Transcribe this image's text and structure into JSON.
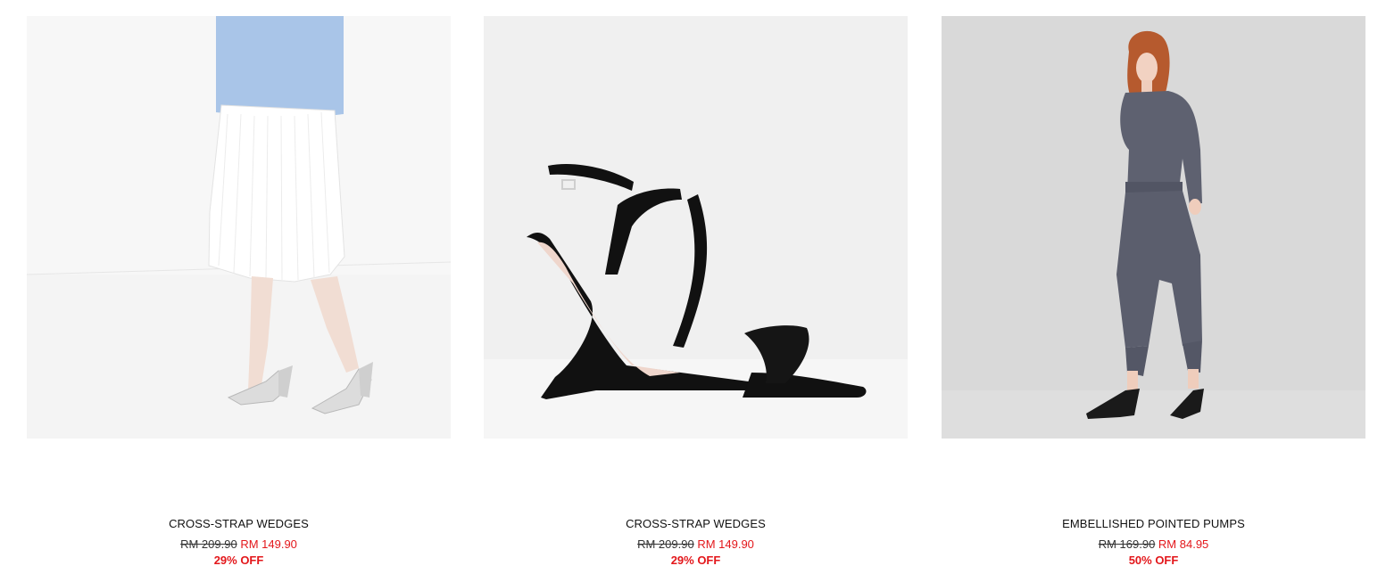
{
  "products": [
    {
      "name": "CROSS-STRAP WEDGES",
      "old_price": "RM 209.90",
      "new_price": "RM 149.90",
      "discount": "29% OFF",
      "image_desc": "model-legs-silver-wedges"
    },
    {
      "name": "CROSS-STRAP WEDGES",
      "old_price": "RM 209.90",
      "new_price": "RM 149.90",
      "discount": "29% OFF",
      "image_desc": "black-cross-strap-wedge"
    },
    {
      "name": "EMBELLISHED POINTED PUMPS",
      "old_price": "RM 169.90",
      "new_price": "RM 84.95",
      "discount": "50% OFF",
      "image_desc": "model-grey-jumpsuit-pumps"
    }
  ],
  "colors": {
    "sale_red": "#e3171b",
    "text": "#111111",
    "image_bg_light": "#f2f2f2",
    "image_bg_grey": "#d9d9d9"
  }
}
